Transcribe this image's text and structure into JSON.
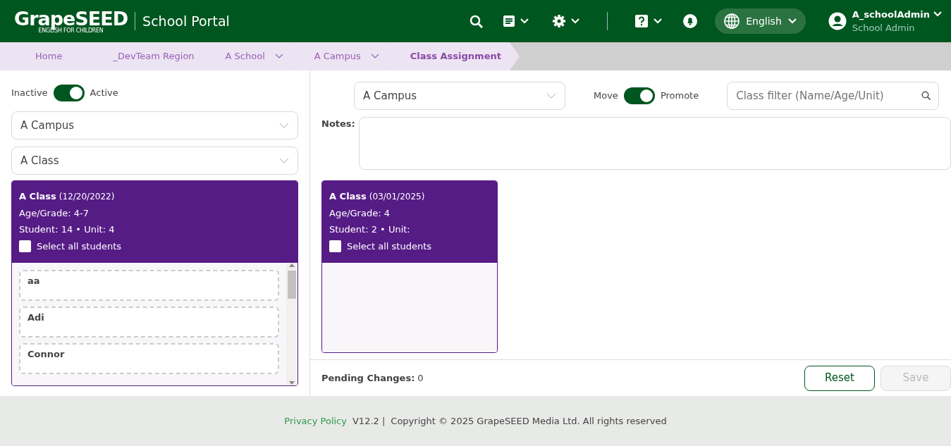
{
  "header": {
    "logo": {
      "wordmark": "GrapeSEED",
      "tagline": "ENGLISH FOR CHILDREN"
    },
    "title": "School Portal",
    "language": "English",
    "user": {
      "name": "A_schoolAdmin",
      "role": "School Admin"
    }
  },
  "breadcrumb": [
    {
      "label": "Home",
      "dropdown": false,
      "selected": false
    },
    {
      "label": "_DevTeam Region",
      "dropdown": false,
      "selected": false
    },
    {
      "label": "A School",
      "dropdown": true,
      "selected": false
    },
    {
      "label": "A Campus",
      "dropdown": true,
      "selected": false
    },
    {
      "label": "Class Assignment",
      "dropdown": false,
      "selected": true
    }
  ],
  "left_panel": {
    "toggle": {
      "off_label": "Inactive",
      "on_label": "Active",
      "on": true
    },
    "campus_select": "A Campus",
    "class_select": "A Class",
    "class_card": {
      "name": "A Class",
      "date": "(12/20/2022)",
      "age_grade": "Age/Grade: 4-7",
      "student_unit": "Student: 14 • Unit: 4",
      "select_all": {
        "label": "Select all students",
        "checked": false
      },
      "students": [
        "aa",
        "Adi",
        "Connor"
      ]
    }
  },
  "right_panel": {
    "campus_select": "A Campus",
    "toggle": {
      "off_label": "Move",
      "on_label": "Promote",
      "on": true
    },
    "filter": {
      "placeholder": "Class filter (Name/Age/Unit)"
    },
    "notes_label": "Notes:",
    "class_cards": [
      {
        "name": "A Class",
        "date": "(03/01/2025)",
        "age_grade": "Age/Grade: 4",
        "student_unit": "Student: 2 • Unit:",
        "select_all": {
          "label": "Select all students",
          "checked": false
        }
      }
    ],
    "pending_label": "Pending Changes:",
    "pending_count": "0",
    "buttons": [
      {
        "label": "Reset",
        "disabled": false
      },
      {
        "label": "Save",
        "disabled": true
      }
    ]
  },
  "footer": {
    "link": "Privacy Policy",
    "version": "V12.2 |",
    "copyright": "Copyright © 2025 GrapeSEED Media Ltd. All rights reserved"
  }
}
